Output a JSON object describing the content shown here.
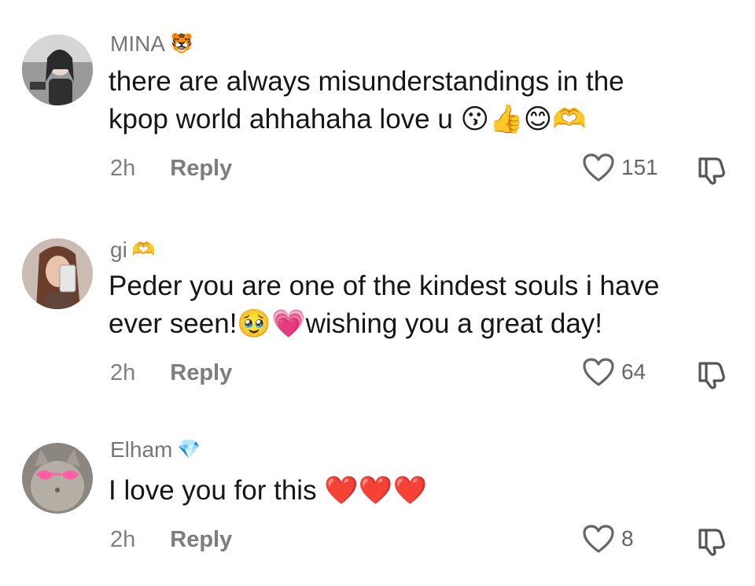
{
  "comments": [
    {
      "username": "MINA",
      "badge": "🐯",
      "line1": "there are always misunderstandings in the",
      "line2": "kpop world ahhahaha love u 😗👍😊🫶",
      "time": "2h",
      "reply_label": "Reply",
      "likes": "151"
    },
    {
      "username": "gi",
      "badge": "🫶",
      "line1": "Peder you are one of the kindest souls i have",
      "line2": "ever seen!🥹💗wishing you a great day!",
      "time": "2h",
      "reply_label": "Reply",
      "likes": "64"
    },
    {
      "username": "Elham",
      "badge": "💎",
      "line1": "I love you for this ❤️❤️❤️",
      "time": "2h",
      "reply_label": "Reply",
      "likes": "8"
    }
  ],
  "icons": {
    "like": "heart-outline-icon",
    "dislike": "thumbs-down-icon"
  }
}
